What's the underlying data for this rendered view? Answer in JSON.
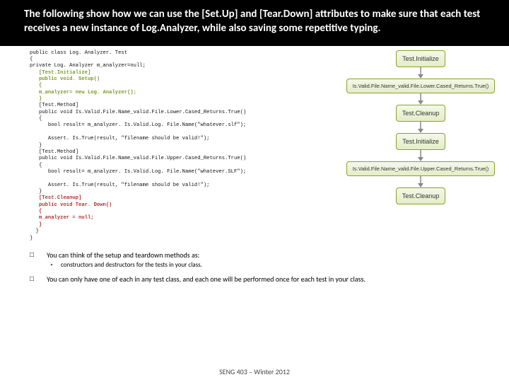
{
  "title": "The following show how we can use the [Set.Up] and [Tear.Down] attributes to make sure that each test receives a new instance of Log.Analyzer, while also saving some repetitive typing.",
  "code": {
    "l01": "public class Log. Analyzer. Test",
    "l02": "{",
    "l03": "private Log. Analyzer m_analyzer=null;",
    "l_init1": "[Test.Initialize]",
    "l_init2": "public void. Setup()",
    "l_init3": "{",
    "l_init4": "m_analyzer= new Log. Analyzer();",
    "l_init5": "}",
    "l08": "[Test.Method]",
    "l09": "public void Is.Valid.File.Name_valid.File.Lower.Cased_Returns.True()",
    "l10": "{",
    "l11": "bool result= m_analyzer. Is.Valid.Log. File.Name(\"whatever.slf\");",
    "l12": "",
    "l13": "Assert. Is.True(result, \"filename should be valid!\");",
    "l14": "}",
    "l15": "[Test.Method]",
    "l16": "public void Is.Valid.File.Name_valid.File.Upper.Cased_Returns.True()",
    "l17": "{",
    "l18": "bool result= m_analyzer. Is.Valid.Log. File.Name(\"whatever.SLF\");",
    "l19": "",
    "l20": "Assert. Is.True(result, \"filename should be valid!\");",
    "l21": "}",
    "l_cl1": "[Test.Cleanup]",
    "l_cl2": "public void Tear. Down()",
    "l_cl3": "{",
    "l_cl4": "m_analyzer = null;",
    "l_cl5": "}",
    "l22": "}",
    "l23": "}"
  },
  "diagram": {
    "b1": "Test.Initialize",
    "b2": "Is.Valid.File.Name_valid.File.Lower.Cased_Returns.True()",
    "b3": "Test.Cleanup",
    "b4": "Test.Initialize",
    "b5": "Is.Valid.File.Name_valid.File.Upper.Cased_Returns.True()",
    "b6": "Test.Cleanup"
  },
  "bullets": {
    "p1": "You can think of the setup and teardown methods as:",
    "p1sub": "constructors and destructors for the tests in your class.",
    "p2": "You can only have one of each in any test class, and each one will be performed once for each test in your class."
  },
  "footer": "SENG 403 – Winter 2012"
}
